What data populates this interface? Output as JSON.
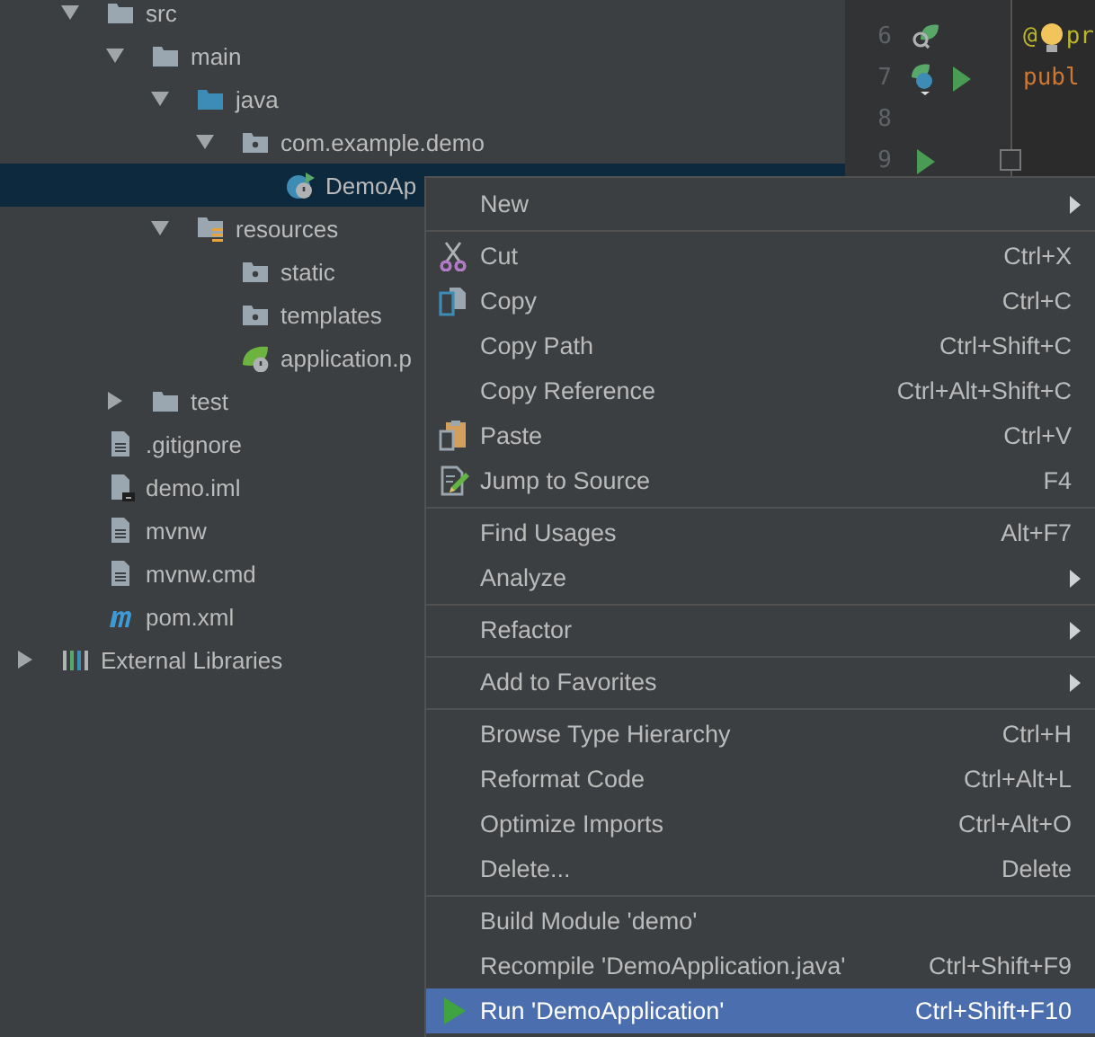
{
  "tree": {
    "items": [
      {
        "label": "src",
        "kind": "folder",
        "expanded": true,
        "selected": false,
        "children": [
          {
            "label": "main",
            "kind": "folder",
            "expanded": true,
            "selected": false,
            "children": [
              {
                "label": "java",
                "kind": "source-folder",
                "expanded": true,
                "selected": false,
                "children": [
                  {
                    "label": "com.example.demo",
                    "kind": "package",
                    "expanded": true,
                    "selected": false,
                    "children": [
                      {
                        "label": "DemoAp",
                        "kind": "spring-class",
                        "selected": true
                      }
                    ]
                  }
                ]
              },
              {
                "label": "resources",
                "kind": "resources-folder",
                "expanded": true,
                "selected": false,
                "children": [
                  {
                    "label": "static",
                    "kind": "package",
                    "selected": false
                  },
                  {
                    "label": "templates",
                    "kind": "package",
                    "selected": false
                  },
                  {
                    "label": "application.p",
                    "kind": "spring-config",
                    "selected": false
                  }
                ]
              }
            ]
          },
          {
            "label": "test",
            "kind": "folder",
            "expanded": false,
            "selected": false
          }
        ]
      },
      {
        "label": ".gitignore",
        "kind": "file",
        "selected": false
      },
      {
        "label": "demo.iml",
        "kind": "module-file",
        "selected": false
      },
      {
        "label": "mvnw",
        "kind": "file",
        "selected": false
      },
      {
        "label": "mvnw.cmd",
        "kind": "file",
        "selected": false
      },
      {
        "label": "pom.xml",
        "kind": "maven",
        "selected": false
      }
    ],
    "libraries": {
      "label": "External Libraries",
      "kind": "libraries",
      "expanded": false,
      "selected": false
    }
  },
  "editor": {
    "lines": [
      {
        "number": "6",
        "gutter_icons": [
          {
            "kind": "bean"
          }
        ],
        "lightbulb": true,
        "code": [
          {
            "text": "@",
            "kind": "annotation"
          },
          {
            "text": "pr",
            "kind": "annotation"
          }
        ]
      },
      {
        "number": "7",
        "gutter_icons": [
          {
            "kind": "class"
          },
          {
            "kind": "run"
          }
        ],
        "lightbulb": false,
        "code": [
          {
            "text": "publ",
            "kind": "keyword"
          }
        ]
      },
      {
        "number": "8",
        "lightbulb": false
      },
      {
        "number": "9",
        "gutter_icons": [
          {
            "kind": "run"
          }
        ],
        "lightbulb": false,
        "fold": true
      }
    ]
  },
  "context_menu": {
    "groups": [
      [
        {
          "label": "New",
          "submenu": true,
          "selected": false
        }
      ],
      [
        {
          "label": "Cut",
          "shortcut": "Ctrl+X",
          "kind": "cut",
          "submenu": false,
          "selected": false
        },
        {
          "label": "Copy",
          "shortcut": "Ctrl+C",
          "kind": "copy",
          "submenu": false,
          "selected": false
        },
        {
          "label": "Copy Path",
          "shortcut": "Ctrl+Shift+C",
          "submenu": false,
          "selected": false
        },
        {
          "label": "Copy Reference",
          "shortcut": "Ctrl+Alt+Shift+C",
          "submenu": false,
          "selected": false
        },
        {
          "label": "Paste",
          "shortcut": "Ctrl+V",
          "kind": "paste",
          "submenu": false,
          "selected": false
        },
        {
          "label": "Jump to Source",
          "shortcut": "F4",
          "kind": "edit",
          "submenu": false,
          "selected": false
        }
      ],
      [
        {
          "label": "Find Usages",
          "shortcut": "Alt+F7",
          "submenu": false,
          "selected": false
        },
        {
          "label": "Analyze",
          "submenu": true,
          "selected": false
        }
      ],
      [
        {
          "label": "Refactor",
          "submenu": true,
          "selected": false
        }
      ],
      [
        {
          "label": "Add to Favorites",
          "submenu": true,
          "selected": false
        }
      ],
      [
        {
          "label": "Browse Type Hierarchy",
          "shortcut": "Ctrl+H",
          "submenu": false,
          "selected": false
        },
        {
          "label": "Reformat Code",
          "shortcut": "Ctrl+Alt+L",
          "submenu": false,
          "selected": false
        },
        {
          "label": "Optimize Imports",
          "shortcut": "Ctrl+Alt+O",
          "submenu": false,
          "selected": false
        },
        {
          "label": "Delete...",
          "shortcut": "Delete",
          "submenu": false,
          "selected": false
        }
      ],
      [
        {
          "label": "Build Module 'demo'",
          "submenu": false,
          "selected": false
        },
        {
          "label": "Recompile 'DemoApplication.java'",
          "shortcut": "Ctrl+Shift+F9",
          "submenu": false,
          "selected": false
        },
        {
          "label": "Run 'DemoApplication'",
          "shortcut": "Ctrl+Shift+F10",
          "kind": "run",
          "submenu": false,
          "selected": true
        }
      ]
    ]
  }
}
